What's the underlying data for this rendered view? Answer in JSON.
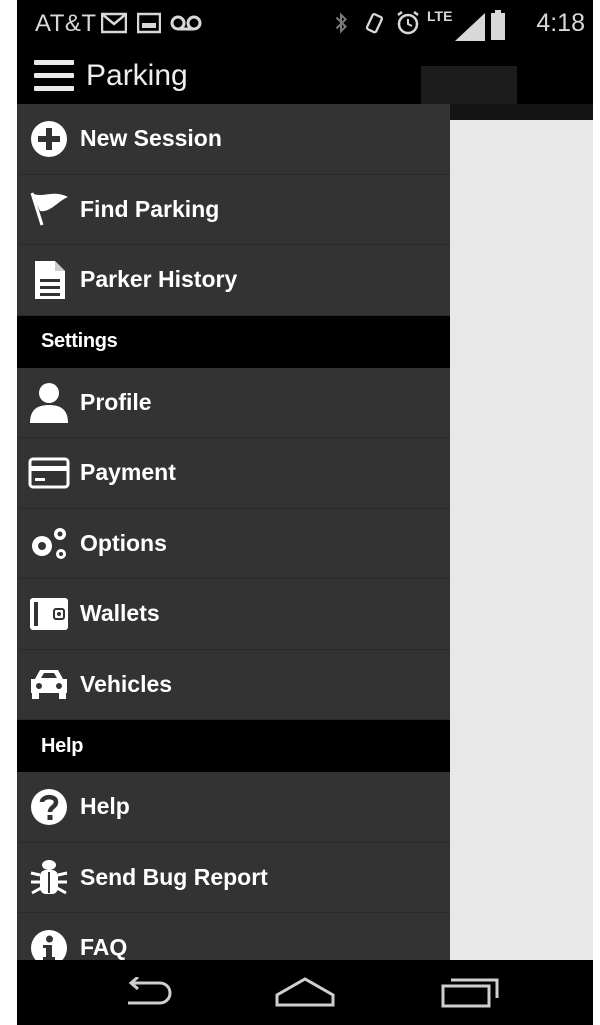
{
  "status_bar": {
    "carrier": "AT&T",
    "time": "4:18",
    "network": "LTE"
  },
  "action_bar": {
    "title": "Parking"
  },
  "drawer": {
    "main_items": [
      {
        "label": "New Session",
        "icon": "plus-circle-icon"
      },
      {
        "label": "Find Parking",
        "icon": "flag-icon"
      },
      {
        "label": "Parker History",
        "icon": "document-icon"
      }
    ],
    "settings_header": "Settings",
    "settings_items": [
      {
        "label": "Profile",
        "icon": "person-icon"
      },
      {
        "label": "Payment",
        "icon": "credit-card-icon"
      },
      {
        "label": "Options",
        "icon": "gears-icon"
      },
      {
        "label": "Wallets",
        "icon": "wallet-icon"
      },
      {
        "label": "Vehicles",
        "icon": "car-icon"
      }
    ],
    "help_header": "Help",
    "help_items": [
      {
        "label": "Help",
        "icon": "question-circle-icon"
      },
      {
        "label": "Send Bug Report",
        "icon": "bug-icon"
      },
      {
        "label": "FAQ",
        "icon": "info-circle-icon"
      }
    ]
  },
  "nav_bar": {
    "icons": [
      "back-icon",
      "home-icon",
      "recent-apps-icon"
    ]
  },
  "colors": {
    "drawer_bg": "#333333",
    "section_bg": "#000000",
    "text": "#ffffff",
    "content_bg": "#e8e8e8"
  }
}
